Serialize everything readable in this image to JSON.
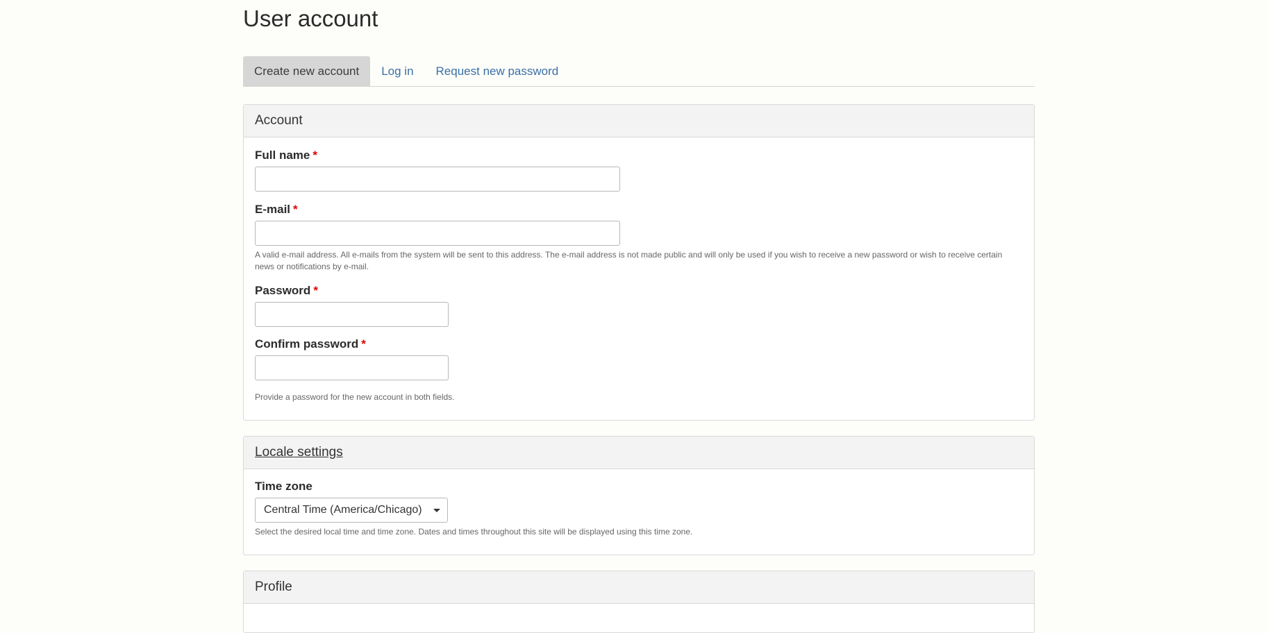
{
  "page": {
    "title": "User account"
  },
  "tabs": [
    {
      "label": "Create new account",
      "active": true
    },
    {
      "label": "Log in",
      "active": false
    },
    {
      "label": "Request new password",
      "active": false
    }
  ],
  "account": {
    "legend": "Account",
    "full_name": {
      "label": "Full name",
      "required_marker": "*",
      "value": ""
    },
    "email": {
      "label": "E-mail",
      "required_marker": "*",
      "value": "",
      "description": "A valid e-mail address. All e-mails from the system will be sent to this address. The e-mail address is not made public and will only be used if you wish to receive a new password or wish to receive certain news or notifications by e-mail."
    },
    "password": {
      "label": "Password",
      "required_marker": "*",
      "value": ""
    },
    "confirm_password": {
      "label": "Confirm password",
      "required_marker": "*",
      "value": "",
      "description": "Provide a password for the new account in both fields."
    }
  },
  "locale": {
    "legend": "Locale settings",
    "time_zone": {
      "label": "Time zone",
      "selected": "Central Time (America/Chicago)",
      "description": "Select the desired local time and time zone. Dates and times throughout this site will be displayed using this time zone."
    }
  },
  "profile": {
    "legend": "Profile"
  },
  "colors": {
    "background": "#fdfdf9",
    "link": "#3a6fa6",
    "required": "#e00000",
    "active_tab": "#d6d6d6"
  }
}
